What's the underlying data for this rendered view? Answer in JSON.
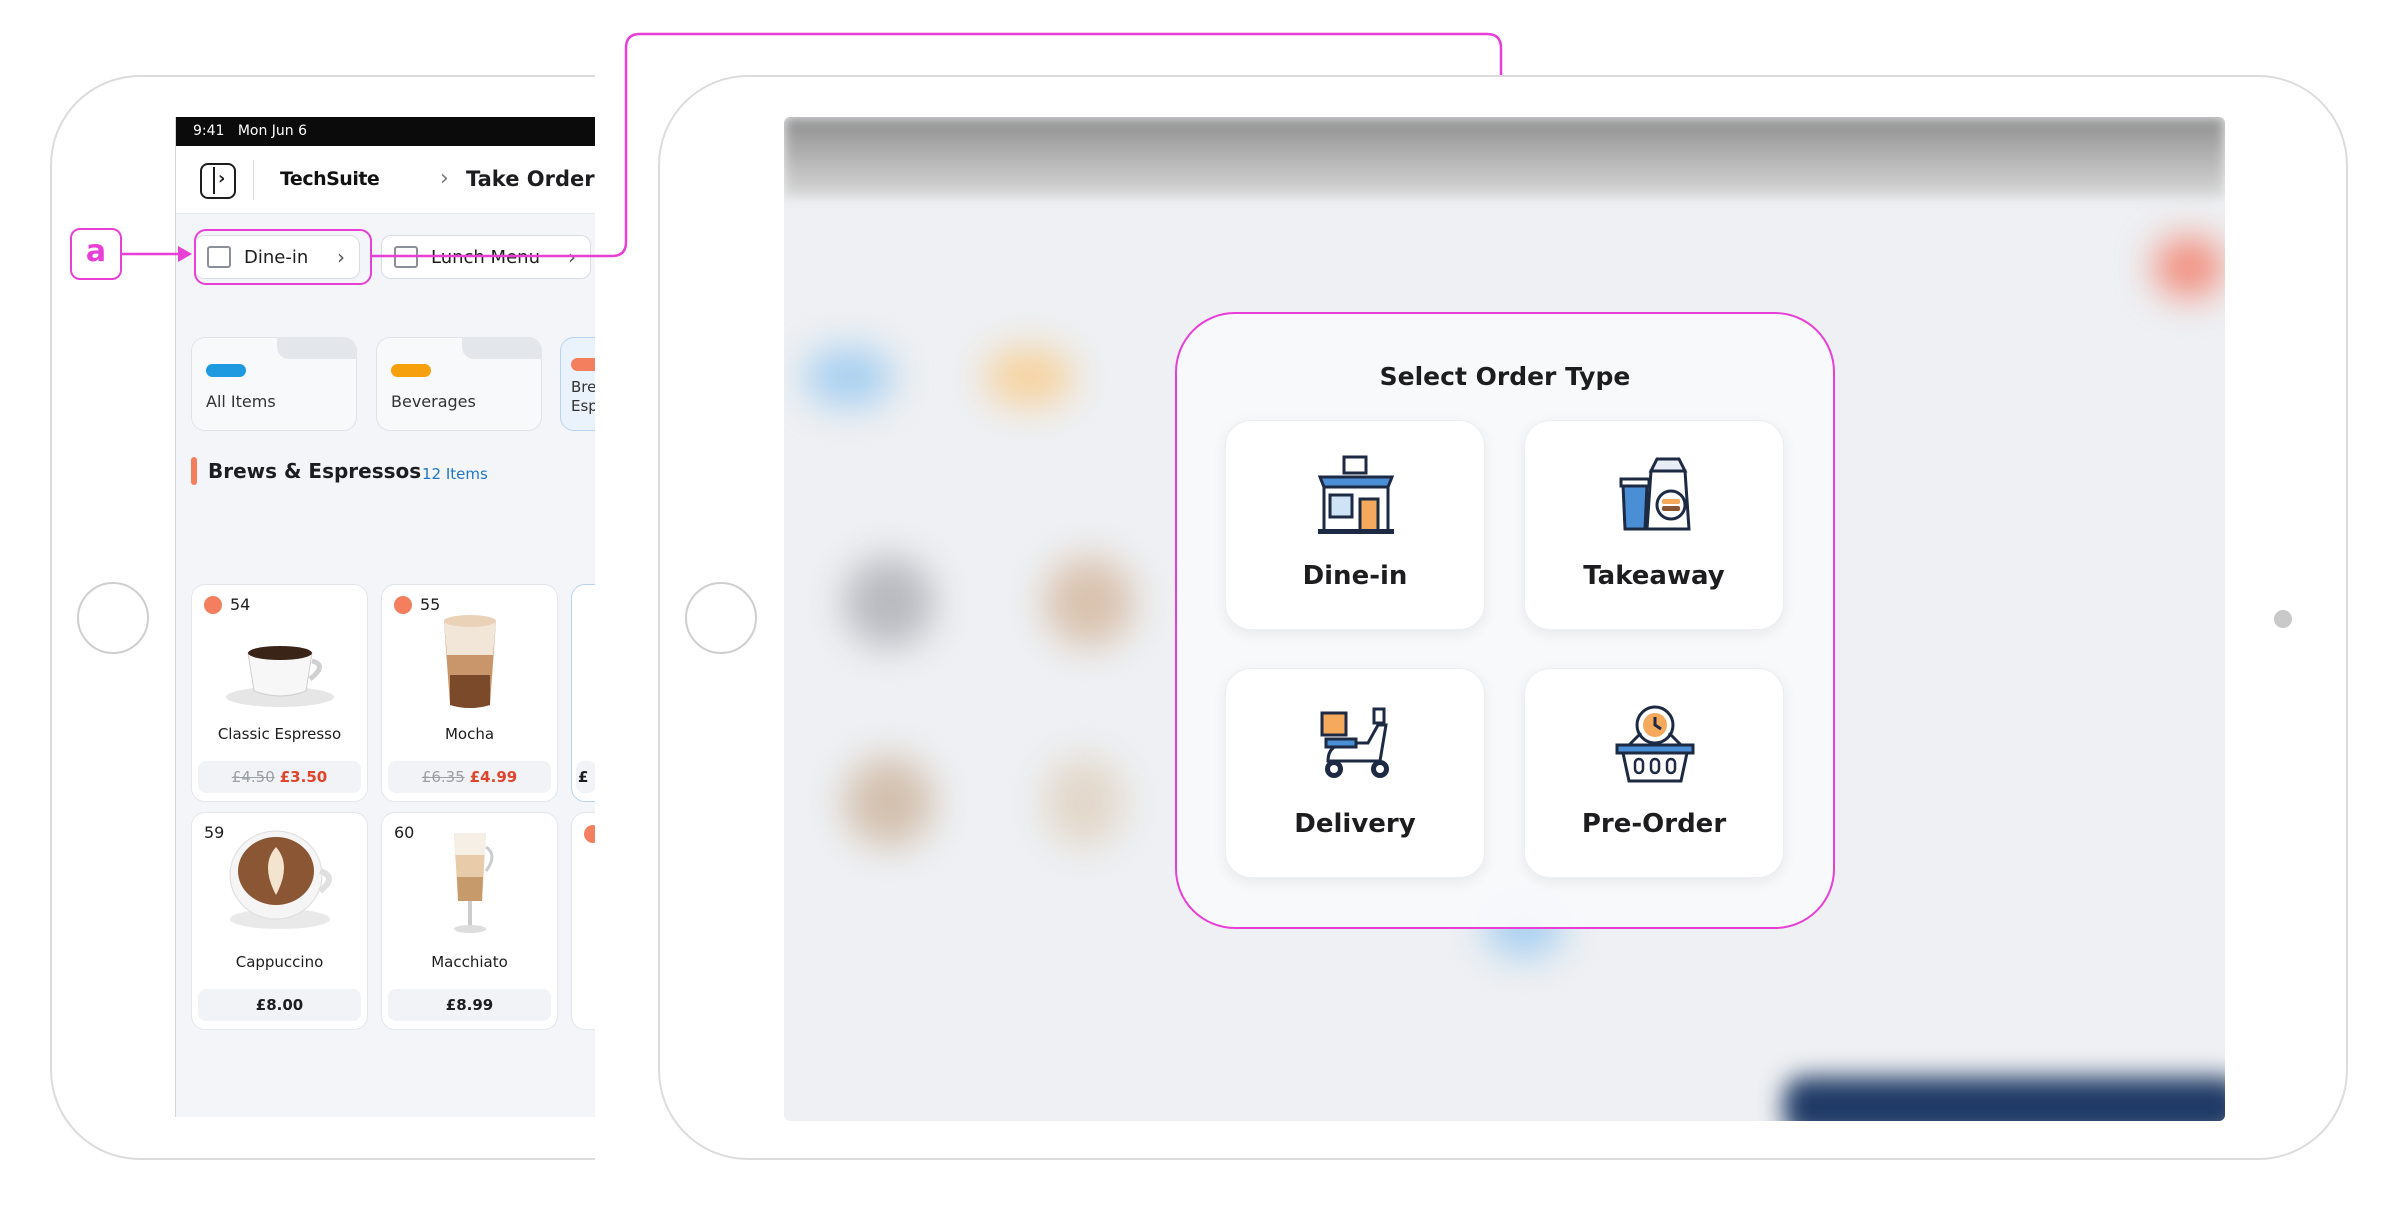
{
  "annotation": {
    "label": "a",
    "color": "#e83fd6"
  },
  "left_screen": {
    "status_bar": {
      "time": "9:41",
      "date": "Mon Jun 6"
    },
    "header": {
      "brand": "TechSuite",
      "title": "Take Order"
    },
    "selectors": {
      "order_type": "Dine-in",
      "menu": "Lunch Menu"
    },
    "categories": [
      {
        "label": "All Items",
        "color": "#1e9be0"
      },
      {
        "label": "Beverages",
        "color": "#f5a00c"
      },
      {
        "label": "Brews & Espressos",
        "color": "#f47f5f"
      }
    ],
    "category_partial": [
      "Bre",
      "Esp"
    ],
    "section": {
      "title": "Brews & Espressos",
      "count": "12 Items"
    },
    "products": [
      {
        "number": "54",
        "name": "Classic Espresso",
        "old_price": "£4.50",
        "price": "£3.50"
      },
      {
        "number": "55",
        "name": "Mocha",
        "old_price": "£6.35",
        "price": "£4.99"
      },
      {
        "number": "59",
        "name": "Cappuccino",
        "price": "£8.00"
      },
      {
        "number": "60",
        "name": "Macchiato",
        "price": "£8.99"
      }
    ],
    "partial_price": "£"
  },
  "order_modal": {
    "title": "Select Order Type",
    "options": [
      {
        "label": "Dine-in",
        "icon": "storefront-icon"
      },
      {
        "label": "Takeaway",
        "icon": "takeaway-bag-icon"
      },
      {
        "label": "Delivery",
        "icon": "scooter-icon"
      },
      {
        "label": "Pre-Order",
        "icon": "basket-clock-icon"
      }
    ]
  }
}
